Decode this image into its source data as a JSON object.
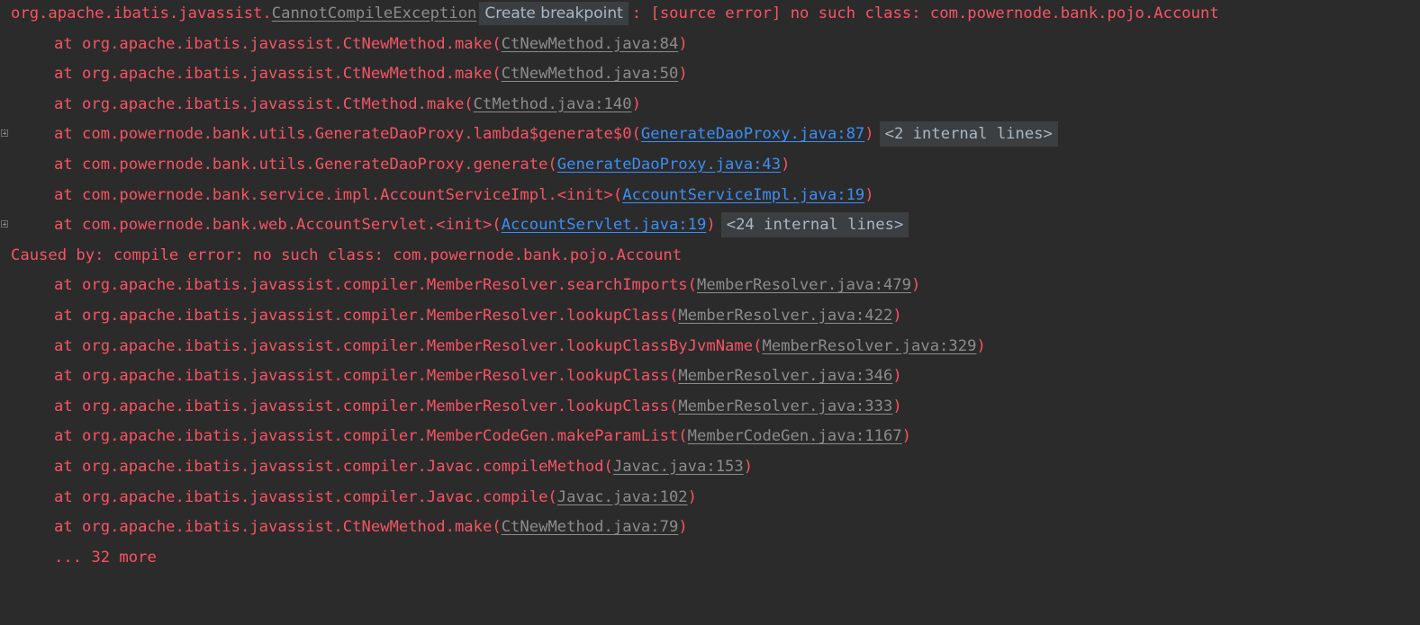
{
  "console": {
    "header": {
      "prefix": "org.apache.ibatis.javassist.",
      "exception_class": "CannotCompileException",
      "breakpoint_chip": "Create breakpoint",
      "message": ": [source error] no such class: com.powernode.bank.pojo.Account"
    },
    "caused_by": "Caused by: compile error: no such class: com.powernode.bank.pojo.Account",
    "more": "... 32 more",
    "frames1": [
      {
        "method": "at org.apache.ibatis.javassist.CtNewMethod.make(",
        "link": "CtNewMethod.java:84",
        "close": ")",
        "style": "gray"
      },
      {
        "method": "at org.apache.ibatis.javassist.CtNewMethod.make(",
        "link": "CtNewMethod.java:50",
        "close": ")",
        "style": "gray"
      },
      {
        "method": "at org.apache.ibatis.javassist.CtMethod.make(",
        "link": "CtMethod.java:140",
        "close": ")",
        "style": "gray"
      },
      {
        "method": "at com.powernode.bank.utils.GenerateDaoProxy.lambda$generate$0(",
        "link": "GenerateDaoProxy.java:87",
        "close": ")",
        "style": "blue",
        "fold": "<2 internal lines>"
      },
      {
        "method": "at com.powernode.bank.utils.GenerateDaoProxy.generate(",
        "link": "GenerateDaoProxy.java:43",
        "close": ")",
        "style": "blue"
      },
      {
        "method": "at com.powernode.bank.service.impl.AccountServiceImpl.<init>(",
        "link": "AccountServiceImpl.java:19",
        "close": ")",
        "style": "blue"
      },
      {
        "method": "at com.powernode.bank.web.AccountServlet.<init>(",
        "link": "AccountServlet.java:19",
        "close": ")",
        "style": "blue",
        "fold": "<24 internal lines>"
      }
    ],
    "frames2": [
      {
        "method": "at org.apache.ibatis.javassist.compiler.MemberResolver.searchImports(",
        "link": "MemberResolver.java:479",
        "close": ")",
        "style": "gray"
      },
      {
        "method": "at org.apache.ibatis.javassist.compiler.MemberResolver.lookupClass(",
        "link": "MemberResolver.java:422",
        "close": ")",
        "style": "gray"
      },
      {
        "method": "at org.apache.ibatis.javassist.compiler.MemberResolver.lookupClassByJvmName(",
        "link": "MemberResolver.java:329",
        "close": ")",
        "style": "gray"
      },
      {
        "method": "at org.apache.ibatis.javassist.compiler.MemberResolver.lookupClass(",
        "link": "MemberResolver.java:346",
        "close": ")",
        "style": "gray"
      },
      {
        "method": "at org.apache.ibatis.javassist.compiler.MemberResolver.lookupClass(",
        "link": "MemberResolver.java:333",
        "close": ")",
        "style": "gray"
      },
      {
        "method": "at org.apache.ibatis.javassist.compiler.MemberCodeGen.makeParamList(",
        "link": "MemberCodeGen.java:1167",
        "close": ")",
        "style": "gray"
      },
      {
        "method": "at org.apache.ibatis.javassist.compiler.Javac.compileMethod(",
        "link": "Javac.java:153",
        "close": ")",
        "style": "gray"
      },
      {
        "method": "at org.apache.ibatis.javassist.compiler.Javac.compile(",
        "link": "Javac.java:102",
        "close": ")",
        "style": "gray"
      },
      {
        "method": "at org.apache.ibatis.javassist.CtNewMethod.make(",
        "link": "CtNewMethod.java:79",
        "close": ")",
        "style": "gray"
      }
    ]
  }
}
